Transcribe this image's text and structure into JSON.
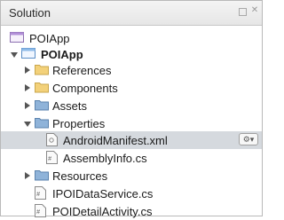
{
  "panel": {
    "title": "Solution"
  },
  "tree": {
    "solution": "POIApp",
    "project": "POIApp",
    "items": [
      {
        "label": "References"
      },
      {
        "label": "Components"
      },
      {
        "label": "Assets"
      },
      {
        "label": "Properties"
      },
      {
        "label": "AndroidManifest.xml"
      },
      {
        "label": "AssemblyInfo.cs"
      },
      {
        "label": "Resources"
      },
      {
        "label": "IPOIDataService.cs"
      },
      {
        "label": "POIDetailActivity.cs"
      }
    ]
  },
  "colors": {
    "folder_yellow": "#f3d17a",
    "folder_blue": "#7ea6cf",
    "selection": "#d5d9de",
    "project_blue": "#4a90d9"
  },
  "icons": {
    "solution": "solution-icon",
    "project": "project-icon",
    "folder": "folder-icon",
    "file": "file-icon",
    "gear": "gear-icon"
  }
}
